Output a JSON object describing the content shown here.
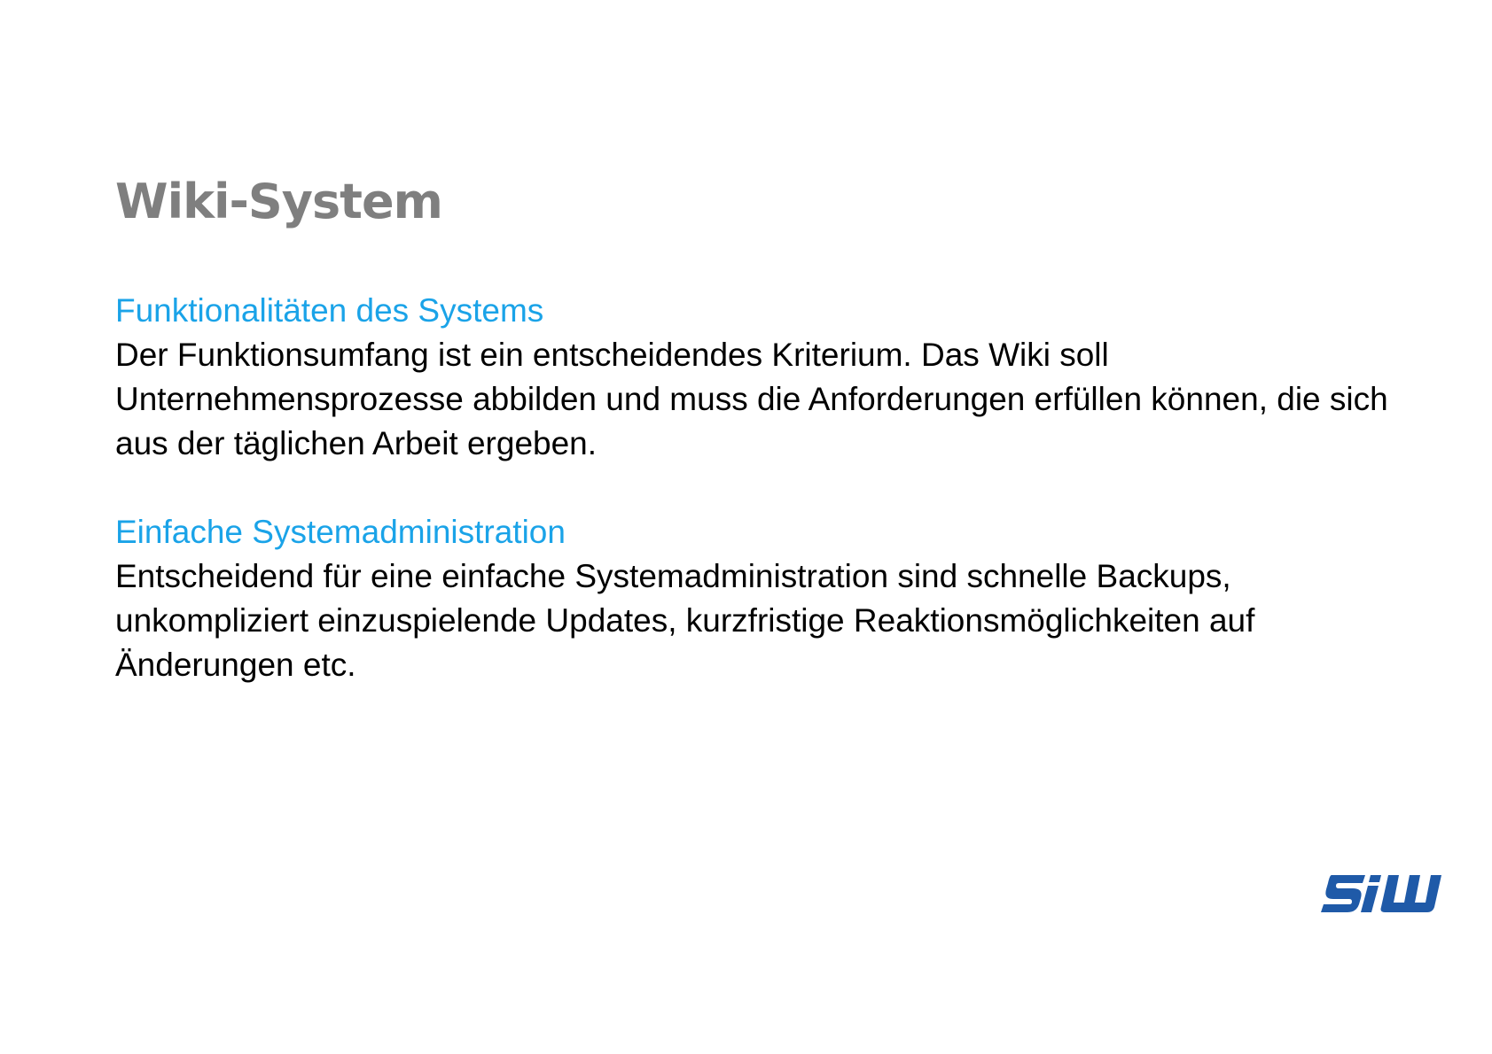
{
  "slide": {
    "title": "Wiki-System",
    "sections": [
      {
        "heading": "Funktionalitäten des Systems",
        "body": "Der Funktionsumfang ist ein entscheidendes Kriterium. Das Wiki soll Unternehmensprozesse abbilden und muss die Anforderungen erfüllen können, die sich aus der täglichen Arbeit ergeben."
      },
      {
        "heading": "Einfache Systemadministration",
        "body": "Entscheidend für eine einfache Systemadministration sind schnelle Backups, unkompliziert einzuspielende Updates, kurzfristige Reaktionsmöglichkeiten auf Änderungen etc."
      }
    ]
  },
  "logo": {
    "text": "SiW",
    "color": "#1f5aa8"
  },
  "colors": {
    "title": "#7f7f7f",
    "heading": "#1aa3e8",
    "body": "#000000"
  }
}
